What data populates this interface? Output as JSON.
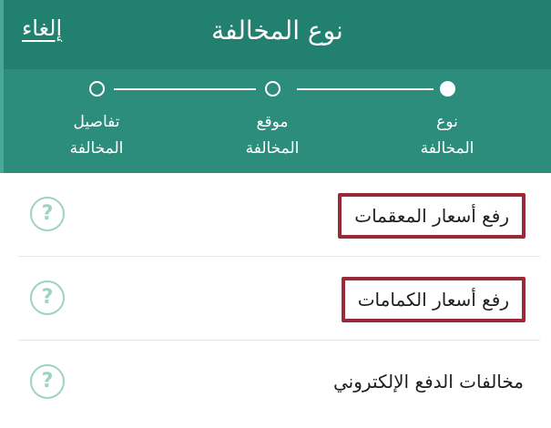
{
  "header": {
    "title": "نوع المخالفة",
    "cancel_label": "إلغاء"
  },
  "stepper": {
    "steps": [
      {
        "label": "نوع\nالمخالفة",
        "active": true
      },
      {
        "label": "موقع\nالمخالفة",
        "active": false
      },
      {
        "label": "تفاصيل\nالمخالفة",
        "active": false
      }
    ]
  },
  "list": {
    "items": [
      {
        "label": "رفع أسعار المعقمات",
        "highlighted": true
      },
      {
        "label": "رفع أسعار الكمامات",
        "highlighted": true
      },
      {
        "label": "مخالفات الدفع الإلكتروني",
        "highlighted": false
      }
    ],
    "help_glyph": "?"
  },
  "colors": {
    "header_bg": "#21806f",
    "stepper_bg": "#2d8d7d",
    "highlight_border": "#9a2a37",
    "help_icon": "#9bd3c4"
  }
}
